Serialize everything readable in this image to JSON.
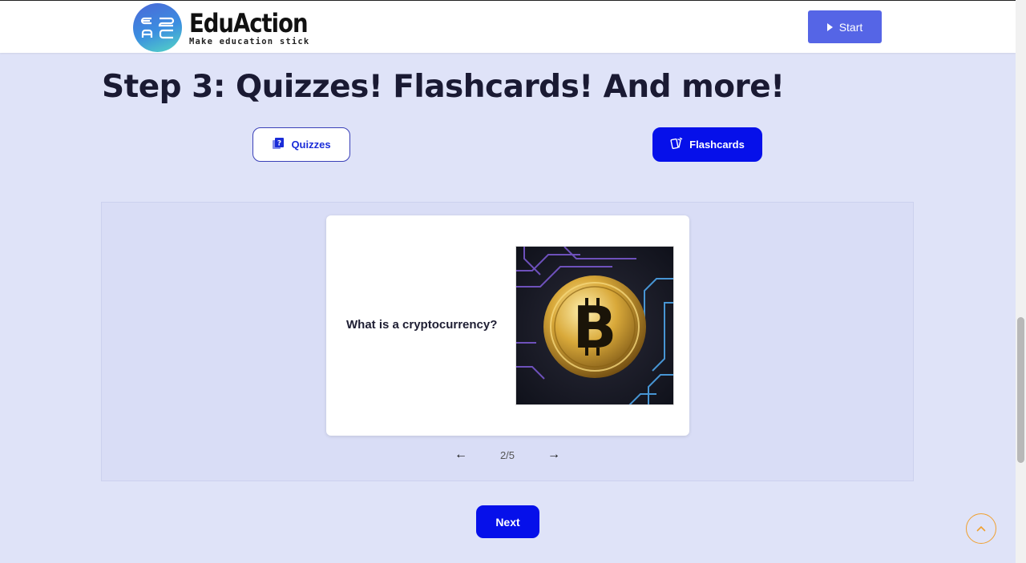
{
  "brand": {
    "name": "EduAction",
    "tagline": "Make education stick"
  },
  "header": {
    "start_label": "Start"
  },
  "section": {
    "title": "Step 3: Quizzes! Flashcards! And more!"
  },
  "tabs": [
    {
      "label": "Quizzes",
      "icon": "quiz-icon",
      "active": false
    },
    {
      "label": "Flashcards",
      "icon": "flashcards-icon",
      "active": true
    }
  ],
  "flashcard": {
    "question": "What is a cryptocurrency?",
    "image": "bitcoin-coin-image"
  },
  "pager": {
    "text": "2/5",
    "current": 2,
    "total": 5
  },
  "next_label": "Next",
  "colors": {
    "page_bg": "#dfe3f8",
    "primary": "#0610ea",
    "start_button": "#5565e6",
    "scroll_top_ring": "#f0a030"
  }
}
